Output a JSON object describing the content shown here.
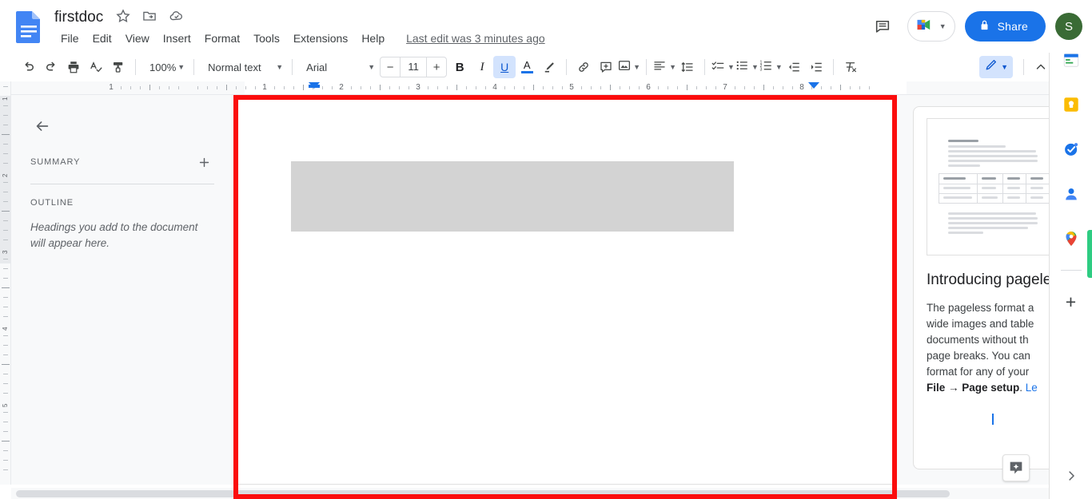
{
  "header": {
    "doc_icon": "google-docs-icon",
    "title": "firstdoc",
    "title_icons": [
      {
        "name": "star-icon",
        "label": "Star"
      },
      {
        "name": "move-to-folder-icon",
        "label": "Move"
      },
      {
        "name": "cloud-saved-icon",
        "label": "Saved to Drive"
      }
    ],
    "menus": [
      "File",
      "Edit",
      "View",
      "Insert",
      "Format",
      "Tools",
      "Extensions",
      "Help"
    ],
    "last_edit": "Last edit was 3 minutes ago",
    "comment_history_icon": "comment-history-icon",
    "meet_icon": "google-meet-icon",
    "share_label": "Share",
    "share_icon": "lock-icon",
    "share_color": "#1a73e8",
    "avatar_initial": "S",
    "avatar_color": "#3a6b35"
  },
  "toolbar": {
    "undo": "undo-icon",
    "redo": "redo-icon",
    "print": "print-icon",
    "spellcheck": "spellcheck-icon",
    "paint_format": "paint-format-icon",
    "zoom_value": "100%",
    "style_value": "Normal text",
    "font_value": "Arial",
    "font_size": "11",
    "font_size_minus": "−",
    "font_size_plus": "+",
    "bold": "B",
    "italic": "I",
    "underline": "U",
    "text_color": "A",
    "text_color_swatch": "#1a73e8",
    "highlight": "highlight-pen-icon",
    "link": "insert-link-icon",
    "comment": "add-comment-icon",
    "image": "insert-image-icon",
    "align": "align-left-icon",
    "line_spacing": "line-spacing-icon",
    "checklist": "checklist-icon",
    "bullet_list": "bulleted-list-icon",
    "numbered_list": "numbered-list-icon",
    "indent_less": "decrease-indent-icon",
    "indent_more": "increase-indent-icon",
    "clear_format": "clear-formatting-icon",
    "edit_mode": "pencil-edit-icon",
    "collapse": "chevron-up-icon",
    "active_accent": "#d3e3fd"
  },
  "ruler": {
    "h_numbers": [
      "1",
      "1",
      "2",
      "3",
      "4",
      "5",
      "6",
      "7"
    ],
    "v_numbers": [
      "1",
      "2",
      "3"
    ]
  },
  "sidebar": {
    "back_icon": "back-arrow-icon",
    "summary_label": "SUMMARY",
    "add_summary_icon": "plus-icon",
    "outline_label": "OUTLINE",
    "outline_empty_text": "Headings you add to the document will appear here."
  },
  "document": {
    "selection_color": "#fb0d0d",
    "paragraph_block_color": "#d3d3d3"
  },
  "promo": {
    "thumbnail": "pageless-document-preview",
    "title": "Introducing pageless format",
    "body_1": "The pageless format a",
    "body_2": "wide images and table",
    "body_3": "documents without th",
    "body_4": "page breaks. You can",
    "body_5": "format for any of your",
    "body_6_bold": "File → Page setup",
    "body_6_rest": ". ",
    "body_6_link": "Le",
    "dots": [
      "",
      "",
      ""
    ]
  },
  "explore": {
    "icon": "explore-sparkle-icon"
  },
  "side_rail": {
    "items": [
      {
        "name": "google-calendar-icon",
        "label": "Calendar"
      },
      {
        "name": "google-keep-icon",
        "label": "Keep"
      },
      {
        "name": "google-tasks-icon",
        "label": "Tasks"
      },
      {
        "name": "google-contacts-icon",
        "label": "Contacts"
      },
      {
        "name": "google-maps-icon",
        "label": "Maps"
      }
    ],
    "add_label": "+",
    "expand_icon": "chevron-right-icon"
  }
}
